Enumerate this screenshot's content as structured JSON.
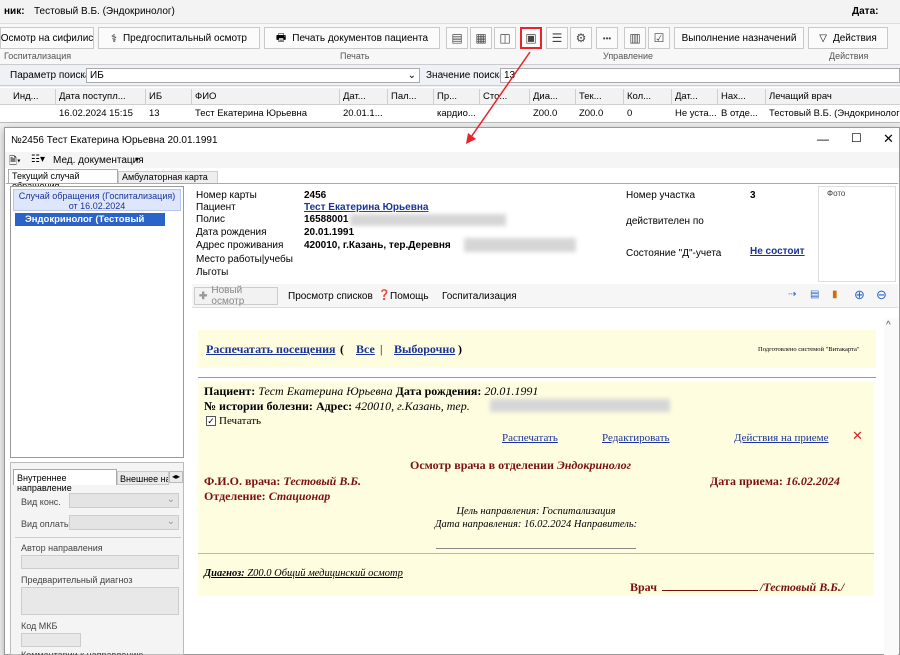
{
  "header": {
    "clinic_label": "ник:",
    "doctor": "Тестовый В.Б. (Эндокринолог)",
    "date_label": "Дата:"
  },
  "toolbar": {
    "syphilis_btn": "Осмотр на сифилис",
    "pre_hosp_btn": "Предгоспитальный осмотр",
    "print_docs_btn": "Печать документов пациента",
    "exec_btn": "Выполнение назначений",
    "actions_btn": "Действия",
    "more_btn": "•••",
    "groups": [
      "Госпитализация",
      "Печать",
      "Управление",
      "Действия"
    ]
  },
  "search": {
    "param_label": "Параметр поиска",
    "param_value": "ИБ",
    "value_label": "Значение поиска",
    "value": "13"
  },
  "grid": {
    "headers": [
      "Инд...",
      "Дата поступл...",
      "ИБ",
      "ФИО",
      "Дат...",
      "Пал...",
      "Пр...",
      "Сто...",
      "Диа...",
      "Тек...",
      "Кол...",
      "Дат...",
      "Нах...",
      "Лечащий врач"
    ],
    "row": [
      "",
      "16.02.2024 15:15",
      "13",
      "Тест Екатерина Юрьевна",
      "20.01.1...",
      "",
      "кардио...",
      "",
      "Z00.0",
      "Z00.0",
      "0",
      "Не уста...",
      "В отде...",
      "Тестовый В.Б. (Эндокринолог"
    ]
  },
  "window": {
    "title": "№2456 Тест Екатерина Юрьевна 20.01.1991",
    "med_docs": "Мед. документация",
    "tabs": [
      "Текущий случай обращения",
      "Амбулаторная карта"
    ],
    "tree_header": "Случай обращения (Госпитализация) от 16.02.2024",
    "tree_item": "Эндокринолог (Тестовый В.Б.)"
  },
  "patient": {
    "card_label": "Номер карты",
    "card_value": "2456",
    "patient_label": "Пациент",
    "patient_value": "Тест Екатерина Юрьевна",
    "policy_label": "Полис",
    "policy_value": "16588001",
    "dob_label": "Дата рождения",
    "dob_value": "20.01.1991",
    "address_label": "Адрес проживания",
    "address_value": "420010, г.Казань, тер.Деревня",
    "work_label": "Место работы|учебы",
    "benefits_label": "Льготы",
    "district_label": "Номер участка",
    "district_value": "3",
    "valid_label": "действителен по",
    "d_label": "Состояние \"Д\"-учета",
    "d_value": "Не состоит",
    "photo_label": "Фото"
  },
  "subtoolbar": {
    "new_exam": "Новый осмотр",
    "view_lists": "Просмотр списков",
    "help": "Помощь",
    "hosp": "Госпитализация"
  },
  "visits": {
    "print": "Распечатать посещения",
    "open": "(",
    "all": "Все",
    "sep": "|",
    "selective": "Выборочно",
    "close": ")",
    "prepared": "Подготовлено системой \"Витакарта\""
  },
  "report": {
    "patient_label": "Пациент:",
    "patient_value": "Тест Екатерина Юрьевна",
    "dob_label": "Дата рождения:",
    "dob_value": "20.01.1991",
    "history_label": "№ истории болезни:",
    "address_label": "Адрес:",
    "address_value": "420010, г.Казань, тер.",
    "print_check": "Печатать",
    "print_link": "Распечатать",
    "edit_link": "Редактировать",
    "actions_link": "Действия на приеме",
    "exam_title": "Осмотр врача в отделении",
    "exam_dept": "Эндокринолог",
    "doctor_label": "Ф.И.О. врача:",
    "doctor_value": "Тестовый В.Б.",
    "date_label": "Дата приема:",
    "date_value": "16.02.2024",
    "dept_label": "Отделение:",
    "dept_value": "Стационар",
    "purpose": "Цель направления: Госпитализация",
    "direction_date": "Дата направления: 16.02.2024 Направитель:",
    "diag_label": "Диагноз:",
    "diag_value": "Z00.0 Общий медицинский осмотр",
    "sign_label": "Врач",
    "sign_value": "/Тестовый В.Б./"
  },
  "bottom": {
    "tabs": [
      "Внутреннее направление",
      "Внешнее на"
    ],
    "kind_label": "Вид конс.",
    "pay_label": "Вид оплаты",
    "author_label": "Автор направления",
    "prediag_label": "Предварительный диагноз",
    "mkb_label": "Код МКБ",
    "comment_label": "Комментарии к направлению"
  },
  "colors": {
    "highlight": "#e8232a",
    "link": "#1a3399",
    "report_bg": "#fefde0",
    "report_text": "#7a1010"
  }
}
